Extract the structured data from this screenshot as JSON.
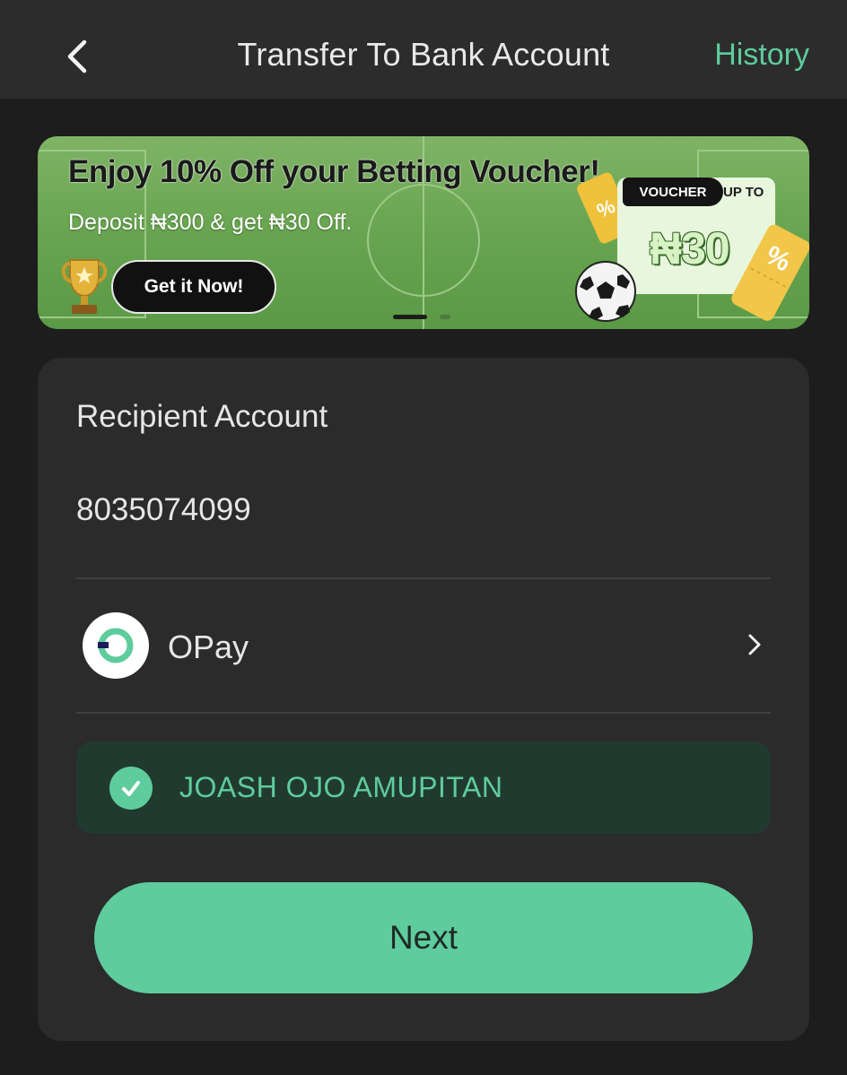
{
  "header": {
    "title": "Transfer To Bank Account",
    "history_label": "History",
    "back_icon": "chevron-left-icon"
  },
  "banner": {
    "title": "Enjoy 10% Off your Betting Voucher!",
    "subtitle": "Deposit ₦300 & get ₦30 Off.",
    "cta_label": "Get it Now!",
    "voucher_tag": "VOUCHER",
    "voucher_upto": "UP TO",
    "voucher_amount": "₦30",
    "ticket_symbol": "%",
    "slide_count": 2,
    "active_slide": 1
  },
  "form": {
    "section_label": "Recipient Account",
    "account_number": "8035074099",
    "bank_name": "OPay",
    "account_name": "JOASH OJO AMUPITAN",
    "next_label": "Next"
  },
  "colors": {
    "accent": "#5ecc9c",
    "background": "#1d1d1d",
    "card": "#2b2b2b",
    "verified_bg": "#213a30"
  }
}
